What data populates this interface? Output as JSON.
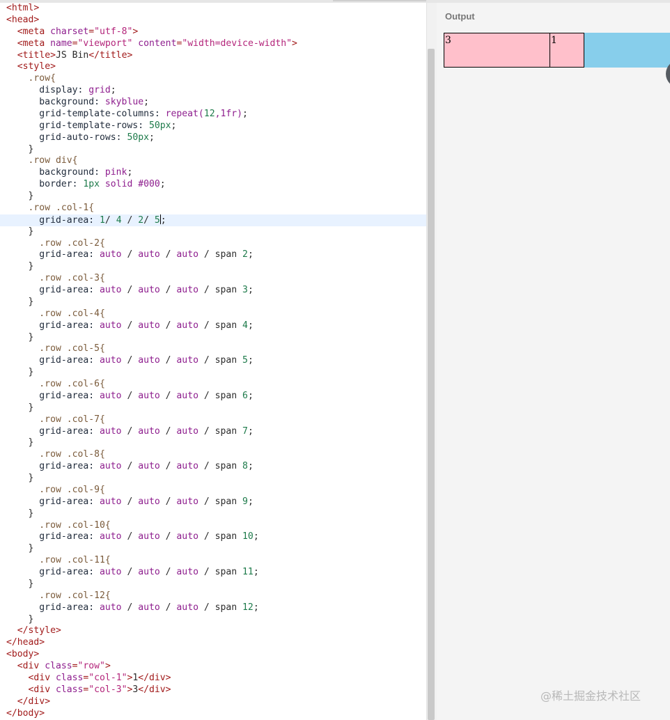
{
  "output_panel": {
    "label": "Output"
  },
  "rendered_grid": {
    "cells": [
      "3",
      "1"
    ]
  },
  "watermark": "@稀土掘金技术社区",
  "editor_lines": [
    [
      [
        "tag",
        "<html>"
      ]
    ],
    [
      [
        "tag",
        "<head>"
      ]
    ],
    [
      [
        "txt",
        "  "
      ],
      [
        "tag",
        "<meta "
      ],
      [
        "attr",
        "charset"
      ],
      [
        "tag",
        "="
      ],
      [
        "str",
        "\"utf-8\""
      ],
      [
        "tag",
        ">"
      ]
    ],
    [
      [
        "txt",
        "  "
      ],
      [
        "tag",
        "<meta "
      ],
      [
        "attr",
        "name"
      ],
      [
        "tag",
        "="
      ],
      [
        "str",
        "\"viewport\""
      ],
      [
        "txt",
        " "
      ],
      [
        "attr",
        "content"
      ],
      [
        "tag",
        "="
      ],
      [
        "str",
        "\"width=device-width\""
      ],
      [
        "tag",
        ">"
      ]
    ],
    [
      [
        "txt",
        "  "
      ],
      [
        "tag",
        "<title>"
      ],
      [
        "txt",
        "JS Bin"
      ],
      [
        "tag",
        "</title>"
      ]
    ],
    [
      [
        "txt",
        "  "
      ],
      [
        "tag",
        "<style>"
      ]
    ],
    [
      [
        "sel",
        "    .row{"
      ]
    ],
    [
      [
        "prop",
        "      display: "
      ],
      [
        "val",
        "grid"
      ],
      [
        "txt",
        ";"
      ]
    ],
    [
      [
        "prop",
        "      background: "
      ],
      [
        "val",
        "skyblue"
      ],
      [
        "txt",
        ";"
      ]
    ],
    [
      [
        "prop",
        "      grid-template-columns: "
      ],
      [
        "val",
        "repeat("
      ],
      [
        "num",
        "12"
      ],
      [
        "val",
        ",1fr)"
      ],
      [
        "txt",
        ";"
      ]
    ],
    [
      [
        "prop",
        "      grid-template-rows: "
      ],
      [
        "num",
        "50px"
      ],
      [
        "txt",
        ";"
      ]
    ],
    [
      [
        "prop",
        "      grid-auto-rows: "
      ],
      [
        "num",
        "50px"
      ],
      [
        "txt",
        ";"
      ]
    ],
    [
      [
        "txt",
        "    }"
      ]
    ],
    [
      [
        "sel",
        "    .row div{"
      ]
    ],
    [
      [
        "prop",
        "      background: "
      ],
      [
        "val",
        "pink"
      ],
      [
        "txt",
        ";"
      ]
    ],
    [
      [
        "prop",
        "      border: "
      ],
      [
        "num",
        "1px"
      ],
      [
        "val",
        " solid #000"
      ],
      [
        "txt",
        ";"
      ]
    ],
    [
      [
        "txt",
        "    }"
      ]
    ],
    [
      [
        "sel",
        "    .row .col-1{"
      ]
    ],
    [
      [
        "prop",
        "      grid-area: "
      ],
      [
        "num",
        "1"
      ],
      [
        "txt",
        "/ "
      ],
      [
        "num",
        "4"
      ],
      [
        "txt",
        " / "
      ],
      [
        "num",
        "2"
      ],
      [
        "txt",
        "/ "
      ],
      [
        "num",
        "5"
      ],
      [
        "caret",
        ""
      ],
      [
        "txt",
        ";"
      ]
    ],
    [
      [
        "txt",
        "    }"
      ]
    ],
    [
      [
        "sel",
        "      .row .col-2{"
      ]
    ],
    [
      [
        "prop",
        "      grid-area: "
      ],
      [
        "val",
        "auto"
      ],
      [
        "txt",
        " / "
      ],
      [
        "val",
        "auto"
      ],
      [
        "txt",
        " / "
      ],
      [
        "val",
        "auto"
      ],
      [
        "txt",
        " / span "
      ],
      [
        "num",
        "2"
      ],
      [
        "txt",
        ";"
      ]
    ],
    [
      [
        "txt",
        "    }"
      ]
    ],
    [
      [
        "sel",
        "      .row .col-3{"
      ]
    ],
    [
      [
        "prop",
        "      grid-area: "
      ],
      [
        "val",
        "auto"
      ],
      [
        "txt",
        " / "
      ],
      [
        "val",
        "auto"
      ],
      [
        "txt",
        " / "
      ],
      [
        "val",
        "auto"
      ],
      [
        "txt",
        " / span "
      ],
      [
        "num",
        "3"
      ],
      [
        "txt",
        ";"
      ]
    ],
    [
      [
        "txt",
        "    }"
      ]
    ],
    [
      [
        "sel",
        "      .row .col-4{"
      ]
    ],
    [
      [
        "prop",
        "      grid-area: "
      ],
      [
        "val",
        "auto"
      ],
      [
        "txt",
        " / "
      ],
      [
        "val",
        "auto"
      ],
      [
        "txt",
        " / "
      ],
      [
        "val",
        "auto"
      ],
      [
        "txt",
        " / span "
      ],
      [
        "num",
        "4"
      ],
      [
        "txt",
        ";"
      ]
    ],
    [
      [
        "txt",
        "    }"
      ]
    ],
    [
      [
        "sel",
        "      .row .col-5{"
      ]
    ],
    [
      [
        "prop",
        "      grid-area: "
      ],
      [
        "val",
        "auto"
      ],
      [
        "txt",
        " / "
      ],
      [
        "val",
        "auto"
      ],
      [
        "txt",
        " / "
      ],
      [
        "val",
        "auto"
      ],
      [
        "txt",
        " / span "
      ],
      [
        "num",
        "5"
      ],
      [
        "txt",
        ";"
      ]
    ],
    [
      [
        "txt",
        "    }"
      ]
    ],
    [
      [
        "sel",
        "      .row .col-6{"
      ]
    ],
    [
      [
        "prop",
        "      grid-area: "
      ],
      [
        "val",
        "auto"
      ],
      [
        "txt",
        " / "
      ],
      [
        "val",
        "auto"
      ],
      [
        "txt",
        " / "
      ],
      [
        "val",
        "auto"
      ],
      [
        "txt",
        " / span "
      ],
      [
        "num",
        "6"
      ],
      [
        "txt",
        ";"
      ]
    ],
    [
      [
        "txt",
        "    }"
      ]
    ],
    [
      [
        "sel",
        "      .row .col-7{"
      ]
    ],
    [
      [
        "prop",
        "      grid-area: "
      ],
      [
        "val",
        "auto"
      ],
      [
        "txt",
        " / "
      ],
      [
        "val",
        "auto"
      ],
      [
        "txt",
        " / "
      ],
      [
        "val",
        "auto"
      ],
      [
        "txt",
        " / span "
      ],
      [
        "num",
        "7"
      ],
      [
        "txt",
        ";"
      ]
    ],
    [
      [
        "txt",
        "    }"
      ]
    ],
    [
      [
        "sel",
        "      .row .col-8{"
      ]
    ],
    [
      [
        "prop",
        "      grid-area: "
      ],
      [
        "val",
        "auto"
      ],
      [
        "txt",
        " / "
      ],
      [
        "val",
        "auto"
      ],
      [
        "txt",
        " / "
      ],
      [
        "val",
        "auto"
      ],
      [
        "txt",
        " / span "
      ],
      [
        "num",
        "8"
      ],
      [
        "txt",
        ";"
      ]
    ],
    [
      [
        "txt",
        "    }"
      ]
    ],
    [
      [
        "sel",
        "      .row .col-9{"
      ]
    ],
    [
      [
        "prop",
        "      grid-area: "
      ],
      [
        "val",
        "auto"
      ],
      [
        "txt",
        " / "
      ],
      [
        "val",
        "auto"
      ],
      [
        "txt",
        " / "
      ],
      [
        "val",
        "auto"
      ],
      [
        "txt",
        " / span "
      ],
      [
        "num",
        "9"
      ],
      [
        "txt",
        ";"
      ]
    ],
    [
      [
        "txt",
        "    }"
      ]
    ],
    [
      [
        "sel",
        "      .row .col-10{"
      ]
    ],
    [
      [
        "prop",
        "      grid-area: "
      ],
      [
        "val",
        "auto"
      ],
      [
        "txt",
        " / "
      ],
      [
        "val",
        "auto"
      ],
      [
        "txt",
        " / "
      ],
      [
        "val",
        "auto"
      ],
      [
        "txt",
        " / span "
      ],
      [
        "num",
        "10"
      ],
      [
        "txt",
        ";"
      ]
    ],
    [
      [
        "txt",
        "    }"
      ]
    ],
    [
      [
        "sel",
        "      .row .col-11{"
      ]
    ],
    [
      [
        "prop",
        "      grid-area: "
      ],
      [
        "val",
        "auto"
      ],
      [
        "txt",
        " / "
      ],
      [
        "val",
        "auto"
      ],
      [
        "txt",
        " / "
      ],
      [
        "val",
        "auto"
      ],
      [
        "txt",
        " / span "
      ],
      [
        "num",
        "11"
      ],
      [
        "txt",
        ";"
      ]
    ],
    [
      [
        "txt",
        "    }"
      ]
    ],
    [
      [
        "sel",
        "      .row .col-12{"
      ]
    ],
    [
      [
        "prop",
        "      grid-area: "
      ],
      [
        "val",
        "auto"
      ],
      [
        "txt",
        " / "
      ],
      [
        "val",
        "auto"
      ],
      [
        "txt",
        " / "
      ],
      [
        "val",
        "auto"
      ],
      [
        "txt",
        " / span "
      ],
      [
        "num",
        "12"
      ],
      [
        "txt",
        ";"
      ]
    ],
    [
      [
        "txt",
        "    }"
      ]
    ],
    [
      [
        "txt",
        "  "
      ],
      [
        "tag",
        "</style>"
      ]
    ],
    [
      [
        "tag",
        "</head>"
      ]
    ],
    [
      [
        "tag",
        "<body>"
      ]
    ],
    [
      [
        "txt",
        "  "
      ],
      [
        "tag",
        "<div "
      ],
      [
        "attr",
        "class"
      ],
      [
        "tag",
        "="
      ],
      [
        "str",
        "\"row\""
      ],
      [
        "tag",
        ">"
      ]
    ],
    [
      [
        "txt",
        "    "
      ],
      [
        "tag",
        "<div "
      ],
      [
        "attr",
        "class"
      ],
      [
        "tag",
        "="
      ],
      [
        "str",
        "\"col-1\""
      ],
      [
        "tag",
        ">"
      ],
      [
        "txt",
        "1"
      ],
      [
        "tag",
        "</div>"
      ]
    ],
    [
      [
        "txt",
        "    "
      ],
      [
        "tag",
        "<div "
      ],
      [
        "attr",
        "class"
      ],
      [
        "tag",
        "="
      ],
      [
        "str",
        "\"col-3\""
      ],
      [
        "tag",
        ">"
      ],
      [
        "txt",
        "3"
      ],
      [
        "tag",
        "</div>"
      ]
    ],
    [
      [
        "txt",
        "  "
      ],
      [
        "tag",
        "</div>"
      ]
    ],
    [
      [
        "tag",
        "</body>"
      ]
    ]
  ]
}
